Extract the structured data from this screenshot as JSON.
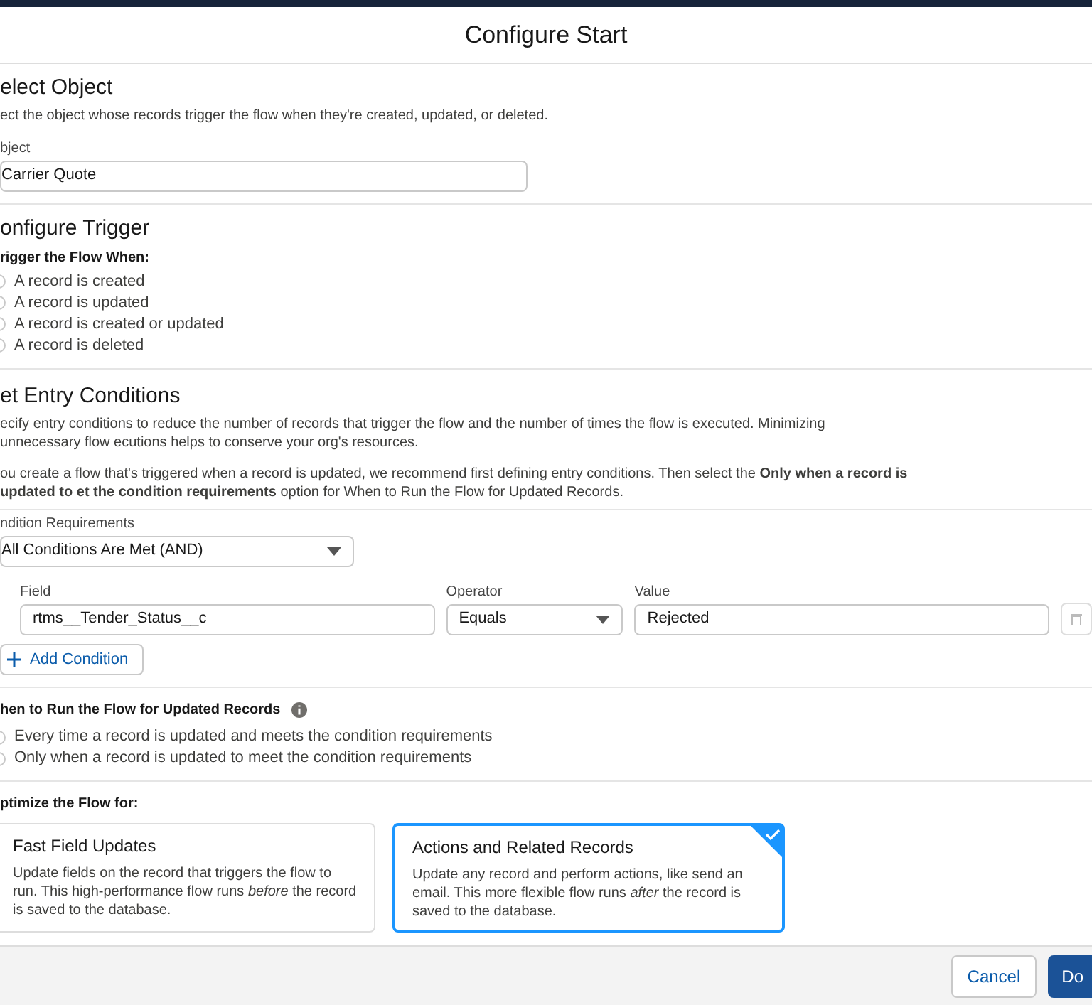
{
  "modal": {
    "title": "Configure Start"
  },
  "select_object": {
    "heading": "elect Object",
    "description": "ect the object whose records trigger the flow when they're created, updated, or deleted.",
    "field_label": "bject",
    "field_value": "Carrier Quote"
  },
  "configure_trigger": {
    "heading": "onfigure Trigger",
    "label": "rigger the Flow When:",
    "options": [
      {
        "label": "A record is created",
        "selected": false
      },
      {
        "label": "A record is updated",
        "selected": false
      },
      {
        "label": "A record is created or updated",
        "selected": false
      },
      {
        "label": "A record is deleted",
        "selected": false
      }
    ]
  },
  "entry_conditions": {
    "heading": "et Entry Conditions",
    "description": "ecify entry conditions to reduce the number of records that trigger the flow and the number of times the flow is executed. Minimizing unnecessary flow ecutions helps to conserve your org's resources.",
    "note": "ou create a flow that's triggered when a record is updated, we recommend first defining entry conditions. Then select the **Only when a record is updated to et the condition requirements** option for When to Run the Flow for Updated Records.",
    "requirements_label": "ndition Requirements",
    "requirements_value": "All Conditions Are Met (AND)",
    "condition": {
      "field_label": "Field",
      "field_value": "rtms__Tender_Status__c",
      "operator_label": "Operator",
      "operator_value": "Equals",
      "value_label": "Value",
      "value_value": "Rejected"
    },
    "add_condition": "Add Condition"
  },
  "run_when": {
    "label": "hen to Run the Flow for Updated Records",
    "options": [
      {
        "label": "Every time a record is updated and meets the condition requirements",
        "selected": false
      },
      {
        "label": "Only when a record is updated to meet the condition requirements",
        "selected": false
      }
    ]
  },
  "optimize": {
    "label": "ptimize the Flow for:",
    "cards": [
      {
        "title": "Fast Field Updates",
        "text": "Update fields on the record that triggers the flow to run. This high-performance flow runs *before* the record is saved to the database.",
        "selected": false
      },
      {
        "title": "Actions and Related Records",
        "text": "Update any record and perform actions, like send an email. This more flexible flow runs *after* the record is saved to the database.",
        "selected": true
      }
    ]
  },
  "footer": {
    "cancel": "Cancel",
    "done": "Do"
  }
}
